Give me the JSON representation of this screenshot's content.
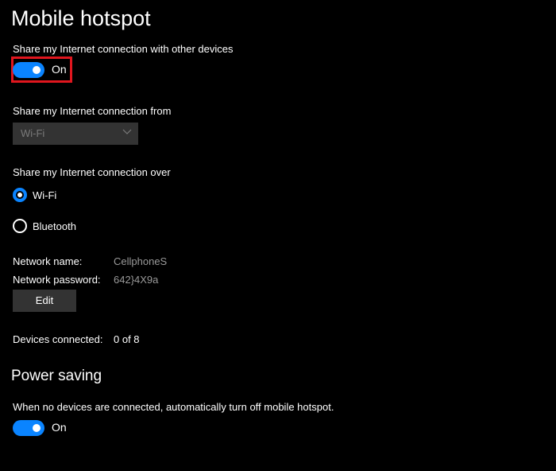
{
  "page": {
    "title": "Mobile hotspot"
  },
  "share": {
    "label": "Share my Internet connection with other devices",
    "toggle_state": "On",
    "toggle_on": true,
    "highlight_color": "#e0161e"
  },
  "share_from": {
    "label": "Share my Internet connection from",
    "selected": "Wi-Fi",
    "icon": "chevron-down-icon"
  },
  "share_over": {
    "label": "Share my Internet connection over",
    "options": [
      {
        "label": "Wi-Fi",
        "checked": true
      },
      {
        "label": "Bluetooth",
        "checked": false
      }
    ]
  },
  "network": {
    "name_label": "Network name:",
    "name_value": "CellphoneS",
    "password_label": "Network password:",
    "password_value": "642}4X9a",
    "edit_button": "Edit"
  },
  "devices": {
    "label": "Devices connected:",
    "value": "0 of 8"
  },
  "power_saving": {
    "title": "Power saving",
    "description": "When no devices are connected, automatically turn off mobile hotspot.",
    "toggle_state": "On",
    "toggle_on": true
  },
  "colors": {
    "accent": "#0a84ff",
    "background": "#000000",
    "control_bg": "#333333",
    "secondary_text": "#9a9a9a"
  }
}
